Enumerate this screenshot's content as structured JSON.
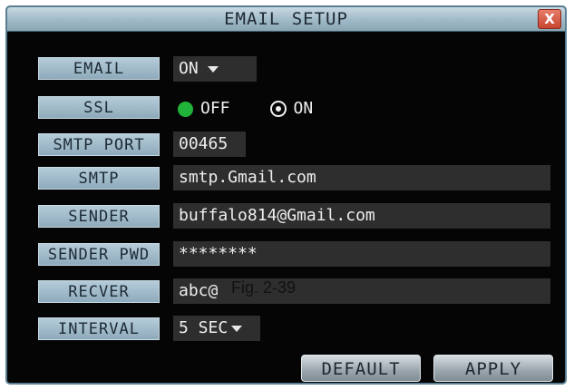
{
  "window": {
    "title": "EMAIL SETUP",
    "close_label": "X"
  },
  "rows": {
    "email": {
      "label": "EMAIL",
      "value": "ON"
    },
    "ssl": {
      "label": "SSL",
      "options": [
        "OFF",
        "ON"
      ],
      "selected": "OFF"
    },
    "smtp_port": {
      "label": "SMTP PORT",
      "value": "00465"
    },
    "smtp": {
      "label": "SMTP",
      "value": "smtp.Gmail.com"
    },
    "sender": {
      "label": "SENDER",
      "value": "buffalo814@Gmail.com"
    },
    "sender_pwd": {
      "label": "SENDER PWD",
      "value": "********"
    },
    "recver": {
      "label": "RECVER",
      "value": "abc@"
    },
    "interval": {
      "label": "INTERVAL",
      "value": "5 SEC"
    }
  },
  "buttons": {
    "default": "DEFAULT",
    "apply": "APPLY"
  },
  "caption": "Fig. 2-39",
  "colors": {
    "background": "#050505",
    "label_bg": "#a5bfcd",
    "field_bg": "#2e2e2e",
    "ssl_selected": "#21b33a",
    "close": "#c7452f"
  },
  "icons": [
    "dropdown-arrow-icon",
    "radio-selected-icon",
    "radio-unselected-icon",
    "close-icon"
  ]
}
